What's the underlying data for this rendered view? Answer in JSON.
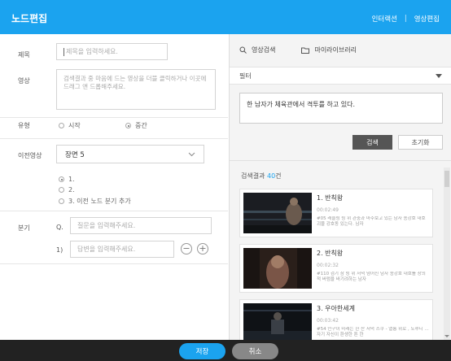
{
  "header": {
    "title": "노드편집",
    "nav_interaction": "인터랙션",
    "nav_separator": "|",
    "nav_video_edit": "영상편집"
  },
  "form": {
    "title_label": "제목",
    "title_placeholder": "제목을 입력하세요.",
    "video_label": "영상",
    "video_placeholder": "검색결과 중 마음에 드는 영상을 더블 클릭하거나 이곳에 드래그 앤 드롭해주세요.",
    "type_label": "유형",
    "type_options": [
      "시작",
      "중간"
    ],
    "type_selected": "중간",
    "prev_video_label": "이전영상",
    "prev_video_selected": "장면 5",
    "prev_options": [
      "1.",
      "2.",
      "3. 이전 노드 분기 추가"
    ],
    "branch_label": "분기",
    "question_prefix": "Q.",
    "question_placeholder": "질문을 입력해주세요.",
    "answer_prefix": "1)",
    "answer_placeholder": "답변을 입력해주세요.",
    "minus_symbol": "−",
    "plus_symbol": "+"
  },
  "search": {
    "tab_video_search": "영상검색",
    "tab_my_library": "마이라이브러리",
    "filter_label": "필터",
    "query_text": "한 남자가 체육관에서 격투를 하고 있다.",
    "search_button": "검색",
    "reset_button": "초기화",
    "results_prefix": "검색결과 ",
    "results_count": "40",
    "results_suffix": "건",
    "results": [
      {
        "name": "1. 반칙왕",
        "duration": "00:02:49",
        "desc": "#05 레슬링 링 위 관중과 마주보고 있는 남자 송강호 대호 괴물 강호동 있는다. 남자"
      },
      {
        "name": "2. 반칙왕",
        "duration": "00:02:32",
        "desc": "#110 검기 삼 링 위 저녁 넘어진 남자 송강호 대호를 장의적 버럼을 바기려하는 남자"
      },
      {
        "name": "3. 우아한세계",
        "duration": "00:03:42",
        "desc": "#54 인구이 미래는 한 산 저녁 스쿠 - 열릉 위로 , 노루디 ... 자기 자신이 환생한 튼 한"
      }
    ]
  },
  "footer": {
    "save_button": "저장",
    "cancel_button": "취소"
  },
  "colors": {
    "brand": "#1ba3ef",
    "dark_bar": "#222222"
  }
}
